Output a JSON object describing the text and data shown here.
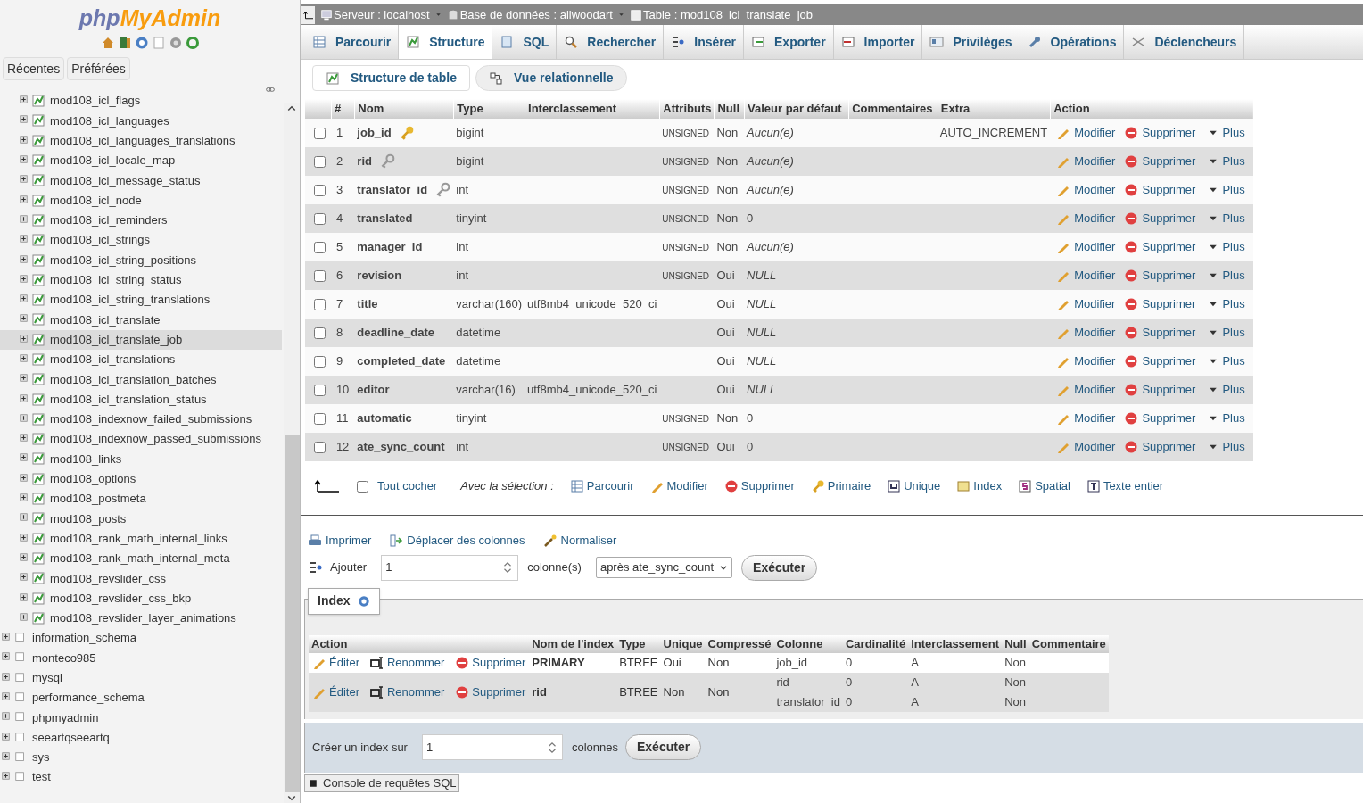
{
  "sidebar": {
    "logo_php": "php",
    "logo_rest": "MyAdmin",
    "tabs": [
      {
        "label": "Récentes"
      },
      {
        "label": "Préférées"
      }
    ],
    "tables": [
      {
        "name": "mod108_icl_flags",
        "selected": false
      },
      {
        "name": "mod108_icl_languages",
        "selected": false
      },
      {
        "name": "mod108_icl_languages_translations",
        "selected": false
      },
      {
        "name": "mod108_icl_locale_map",
        "selected": false
      },
      {
        "name": "mod108_icl_message_status",
        "selected": false
      },
      {
        "name": "mod108_icl_node",
        "selected": false
      },
      {
        "name": "mod108_icl_reminders",
        "selected": false
      },
      {
        "name": "mod108_icl_strings",
        "selected": false
      },
      {
        "name": "mod108_icl_string_positions",
        "selected": false
      },
      {
        "name": "mod108_icl_string_status",
        "selected": false
      },
      {
        "name": "mod108_icl_string_translations",
        "selected": false
      },
      {
        "name": "mod108_icl_translate",
        "selected": false
      },
      {
        "name": "mod108_icl_translate_job",
        "selected": true
      },
      {
        "name": "mod108_icl_translations",
        "selected": false
      },
      {
        "name": "mod108_icl_translation_batches",
        "selected": false
      },
      {
        "name": "mod108_icl_translation_status",
        "selected": false
      },
      {
        "name": "mod108_indexnow_failed_submissions",
        "selected": false
      },
      {
        "name": "mod108_indexnow_passed_submissions",
        "selected": false
      },
      {
        "name": "mod108_links",
        "selected": false
      },
      {
        "name": "mod108_options",
        "selected": false
      },
      {
        "name": "mod108_postmeta",
        "selected": false
      },
      {
        "name": "mod108_posts",
        "selected": false
      },
      {
        "name": "mod108_rank_math_internal_links",
        "selected": false
      },
      {
        "name": "mod108_rank_math_internal_meta",
        "selected": false
      },
      {
        "name": "mod108_revslider_css",
        "selected": false
      },
      {
        "name": "mod108_revslider_css_bkp",
        "selected": false
      },
      {
        "name": "mod108_revslider_layer_animations",
        "selected": false
      }
    ],
    "databases": [
      "information_schema",
      "monteco985",
      "mysql",
      "performance_schema",
      "phpmyadmin",
      "seeartqseeartq",
      "sys",
      "test"
    ]
  },
  "breadcrumb": [
    "Serveur : localhost",
    "Base de données : allwoodart",
    "Table : mod108_icl_translate_job"
  ],
  "tabs": [
    {
      "label": "Parcourir",
      "selected": false
    },
    {
      "label": "Structure",
      "selected": true
    },
    {
      "label": "SQL",
      "selected": false
    },
    {
      "label": "Rechercher",
      "selected": false
    },
    {
      "label": "Insérer",
      "selected": false
    },
    {
      "label": "Exporter",
      "selected": false
    },
    {
      "label": "Importer",
      "selected": false
    },
    {
      "label": "Privilèges",
      "selected": false
    },
    {
      "label": "Opérations",
      "selected": false
    },
    {
      "label": "Déclencheurs",
      "selected": false
    }
  ],
  "subtabs": [
    "Structure de table",
    "Vue relationnelle"
  ],
  "columns_table": {
    "headers": [
      "#",
      "Nom",
      "Type",
      "Interclassement",
      "Attributs",
      "Null",
      "Valeur par défaut",
      "Commentaires",
      "Extra",
      "Action"
    ],
    "rows": [
      {
        "num": "1",
        "name": "job_id",
        "kind": "primary",
        "type": "bigint",
        "attributes": "UNSIGNED",
        "null": "Non",
        "default": "Aucun(e)",
        "default_italic": true,
        "extra": "AUTO_INCREMENT",
        "checked": false,
        "actions": [
          "Modifier",
          "Supprimer",
          "Plus"
        ]
      },
      {
        "num": "2",
        "name": "rid",
        "kind": "indexed",
        "type": "bigint",
        "attributes": "UNSIGNED",
        "null": "Non",
        "default": "Aucun(e)",
        "default_italic": true,
        "checked": false,
        "actions": [
          "Modifier",
          "Supprimer",
          "Plus"
        ]
      },
      {
        "num": "3",
        "name": "translator_id",
        "kind": "indexed",
        "type": "int",
        "attributes": "UNSIGNED",
        "null": "Non",
        "default": "Aucun(e)",
        "default_italic": true,
        "checked": false,
        "actions": [
          "Modifier",
          "Supprimer",
          "Plus"
        ]
      },
      {
        "num": "4",
        "name": "translated",
        "kind": "plain",
        "type": "tinyint",
        "attributes": "UNSIGNED",
        "null": "Non",
        "default": "0",
        "default_italic": false,
        "checked": false,
        "actions": [
          "Modifier",
          "Supprimer",
          "Plus"
        ]
      },
      {
        "num": "5",
        "name": "manager_id",
        "kind": "plain",
        "type": "int",
        "attributes": "UNSIGNED",
        "null": "Non",
        "default": "Aucun(e)",
        "default_italic": true,
        "checked": false,
        "actions": [
          "Modifier",
          "Supprimer",
          "Plus"
        ]
      },
      {
        "num": "6",
        "name": "revision",
        "kind": "plain",
        "type": "int",
        "attributes": "UNSIGNED",
        "null": "Oui",
        "default": "NULL",
        "default_italic": true,
        "checked": false,
        "actions": [
          "Modifier",
          "Supprimer",
          "Plus"
        ]
      },
      {
        "num": "7",
        "name": "title",
        "kind": "plain",
        "type": "varchar(160)",
        "collation": "utf8mb4_unicode_520_ci",
        "null": "Oui",
        "default": "NULL",
        "default_italic": true,
        "checked": false,
        "actions": [
          "Modifier",
          "Supprimer",
          "Plus"
        ]
      },
      {
        "num": "8",
        "name": "deadline_date",
        "kind": "plain",
        "type": "datetime",
        "null": "Oui",
        "default": "NULL",
        "default_italic": true,
        "checked": false,
        "actions": [
          "Modifier",
          "Supprimer",
          "Plus"
        ]
      },
      {
        "num": "9",
        "name": "completed_date",
        "kind": "plain",
        "type": "datetime",
        "null": "Oui",
        "default": "NULL",
        "default_italic": true,
        "checked": false,
        "actions": [
          "Modifier",
          "Supprimer",
          "Plus"
        ]
      },
      {
        "num": "10",
        "name": "editor",
        "kind": "plain",
        "type": "varchar(16)",
        "collation": "utf8mb4_unicode_520_ci",
        "null": "Oui",
        "default": "NULL",
        "default_italic": true,
        "checked": false,
        "actions": [
          "Modifier",
          "Supprimer",
          "Plus"
        ]
      },
      {
        "num": "11",
        "name": "automatic",
        "kind": "plain",
        "type": "tinyint",
        "attributes": "UNSIGNED",
        "null": "Non",
        "default": "0",
        "default_italic": false,
        "checked": false,
        "actions": [
          "Modifier",
          "Supprimer",
          "Plus"
        ]
      },
      {
        "num": "12",
        "name": "ate_sync_count",
        "kind": "plain",
        "type": "int",
        "attributes": "UNSIGNED",
        "null": "Oui",
        "default": "0",
        "default_italic": false,
        "checked": false,
        "actions": [
          "Modifier",
          "Supprimer",
          "Plus"
        ]
      }
    ]
  },
  "selection_bar": {
    "check_all": "Tout cocher",
    "check_all_checked": false,
    "with_selection": "Avec la sélection :",
    "actions": [
      {
        "kind": "browse",
        "label": "Parcourir"
      },
      {
        "kind": "edit",
        "label": "Modifier"
      },
      {
        "kind": "delete",
        "label": "Supprimer"
      },
      {
        "kind": "primary",
        "label": "Primaire"
      },
      {
        "kind": "unique",
        "label": "Unique"
      },
      {
        "kind": "index",
        "label": "Index"
      },
      {
        "kind": "spatial",
        "label": "Spatial"
      },
      {
        "kind": "fulltext",
        "label": "Texte entier"
      }
    ]
  },
  "tools": [
    {
      "kind": "print",
      "label": "Imprimer"
    },
    {
      "kind": "move",
      "label": "Déplacer des colonnes"
    },
    {
      "kind": "normalize",
      "label": "Normaliser"
    }
  ],
  "add_columns": {
    "label": "Ajouter",
    "value": "1",
    "unit": "colonne(s)",
    "position": "après ate_sync_count",
    "button": "Exécuter"
  },
  "indexes": {
    "title": "Index",
    "headers": [
      "Action",
      "Nom de l'index",
      "Type",
      "Unique",
      "Compressé",
      "Colonne",
      "Cardinalité",
      "Interclassement",
      "Null",
      "Commentaire"
    ],
    "rows": [
      {
        "actions": [
          "Éditer",
          "Renommer",
          "Supprimer"
        ],
        "name": "PRIMARY",
        "type": "BTREE",
        "unique": "Oui",
        "packed": "Non",
        "columns": [
          {
            "column": "job_id",
            "cardinality": "0",
            "collation": "A",
            "null": "Non"
          }
        ]
      },
      {
        "actions": [
          "Éditer",
          "Renommer",
          "Supprimer"
        ],
        "name": "rid",
        "type": "BTREE",
        "unique": "Non",
        "packed": "Non",
        "columns": [
          {
            "column": "rid",
            "cardinality": "0",
            "collation": "A",
            "null": "Non"
          },
          {
            "column": "translator_id",
            "cardinality": "0",
            "collation": "A",
            "null": "Non"
          }
        ]
      }
    ],
    "create": {
      "label": "Créer un index sur",
      "value": "1",
      "unit": "colonnes",
      "button": "Exécuter"
    }
  },
  "console": "Console de requêtes SQL"
}
